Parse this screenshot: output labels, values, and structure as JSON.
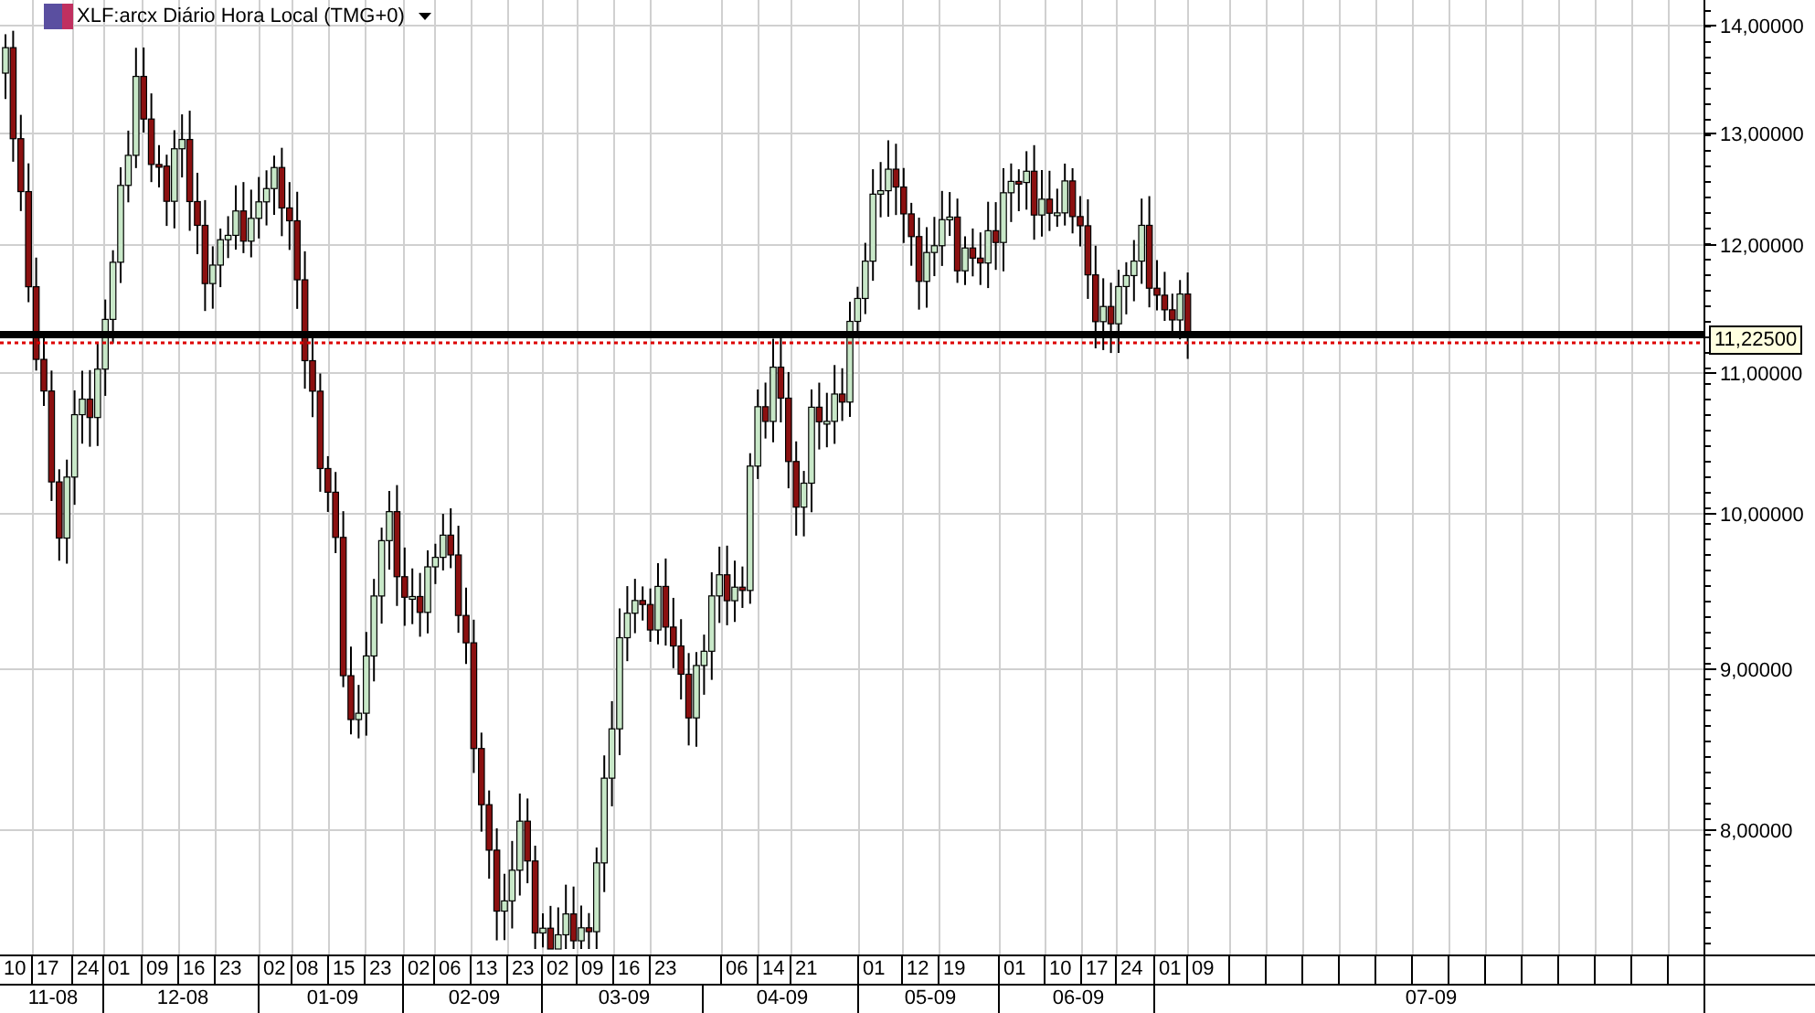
{
  "chart": {
    "title": "XLF:arcx Diário Hora Local (TMG+0)",
    "price_tag": "11,22500",
    "y_labels": [
      "14,00000",
      "13,00000",
      "12,00000",
      "11,00000",
      "10,00000",
      "9,00000",
      "8,00000"
    ],
    "day_labels": [
      "10",
      "17",
      "24",
      "01",
      "09",
      "16",
      "23",
      "02",
      "08",
      "15",
      "23",
      "02",
      "06",
      "13",
      "23",
      "02",
      "09",
      "16",
      "23",
      "06",
      "14",
      "21",
      "01",
      "12",
      "19",
      "01",
      "10",
      "17",
      "24",
      "01",
      "09"
    ],
    "month_labels": [
      "11-08",
      "12-08",
      "01-09",
      "02-09",
      "03-09",
      "04-09",
      "05-09",
      "06-09",
      "07-09"
    ]
  }
}
